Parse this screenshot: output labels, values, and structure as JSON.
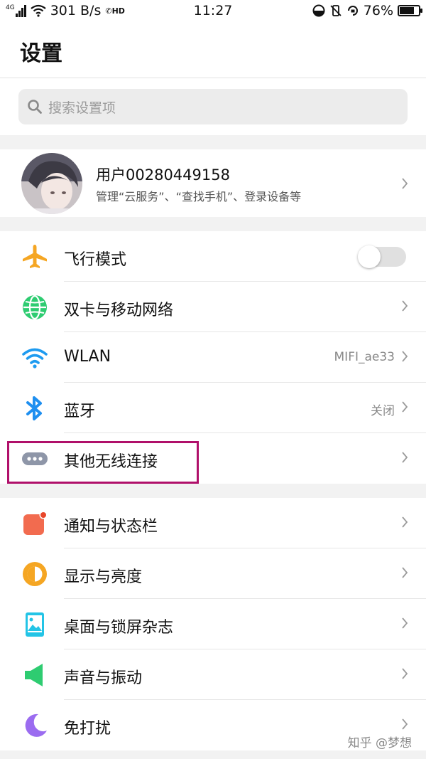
{
  "status_bar": {
    "network": "4G",
    "speed": "301 B/s",
    "hd": "HD",
    "time": "11:27",
    "battery": "76%",
    "battery_level": 0.76
  },
  "header": {
    "title": "设置"
  },
  "search": {
    "placeholder": "搜索设置项"
  },
  "account": {
    "name": "用户00280449158",
    "subtitle": "管理“云服务”、“查找手机”、登录设备等"
  },
  "connectivity": {
    "airplane": {
      "label": "飞行模式",
      "icon": "airplane-icon",
      "enabled": false
    },
    "dual_sim": {
      "label": "双卡与移动网络",
      "icon": "globe-icon"
    },
    "wlan": {
      "label": "WLAN",
      "value": "MIFI_ae33",
      "icon": "wifi-icon"
    },
    "bluetooth": {
      "label": "蓝牙",
      "value": "关闭",
      "icon": "bluetooth-icon"
    },
    "other_wireless": {
      "label": "其他无线连接",
      "icon": "more-dots-icon"
    }
  },
  "device": {
    "notifications": {
      "label": "通知与状态栏",
      "icon": "notification-icon"
    },
    "display": {
      "label": "显示与亮度",
      "icon": "brightness-icon"
    },
    "desktop": {
      "label": "桌面与锁屏杂志",
      "icon": "wallpaper-icon"
    },
    "sound": {
      "label": "声音与振动",
      "icon": "speaker-icon"
    },
    "dnd": {
      "label": "免打扰",
      "icon": "moon-icon"
    }
  },
  "watermark": "知乎 @梦想",
  "colors": {
    "highlight": "#b0106a",
    "airplane": "#f5a623",
    "globe": "#2ecc71",
    "wifi": "#1e9bf0",
    "bluetooth": "#1e8ff0",
    "more": "#8e96a8",
    "notification": "#f26b4f",
    "brightness": "#f5a623",
    "wallpaper": "#23c4e6",
    "sound": "#2ecc71",
    "moon": "#9b6cf0"
  }
}
